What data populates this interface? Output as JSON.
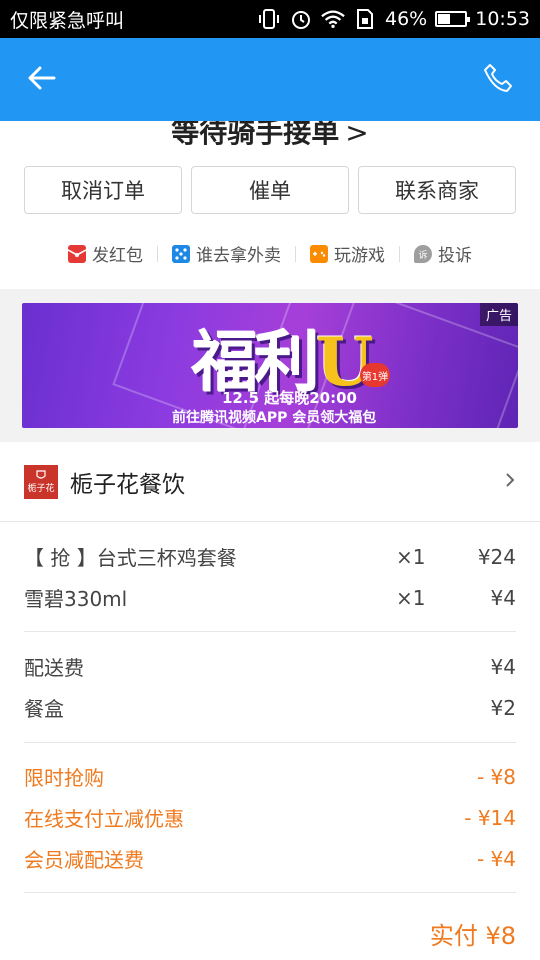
{
  "status_bar": {
    "carrier": "仅限紧急呼叫",
    "battery": "46%",
    "battery_level": 0.46,
    "time": "10:53",
    "icons": [
      "vibrate-icon",
      "alarm-icon",
      "wifi-icon",
      "sim-icon"
    ]
  },
  "app_bar": {
    "back_icon": "arrow-left-icon",
    "phone_icon": "phone-icon",
    "background": "#2196f3"
  },
  "order_status": {
    "title": "等待骑手接单",
    "chevron": ">"
  },
  "buttons": [
    {
      "label": "取消订单"
    },
    {
      "label": "催单"
    },
    {
      "label": "联系商家"
    }
  ],
  "actions": [
    {
      "label": "发红包",
      "icon": "red-envelope-icon",
      "color": "#e53935"
    },
    {
      "label": "谁去拿外卖",
      "icon": "dice-icon",
      "color": "#1e88e5"
    },
    {
      "label": "玩游戏",
      "icon": "gamepad-icon",
      "color": "#fb8c00"
    },
    {
      "label": "投诉",
      "icon": "complaint-icon",
      "color": "#9e9e9e"
    }
  ],
  "ad": {
    "tag": "广告",
    "headline_1": "福利",
    "headline_2": "U",
    "episode": "第1弹",
    "date": "12.5 起每晚20:00",
    "subtitle": "前往腾讯视频APP 会员领大福包"
  },
  "shop": {
    "name": "栀子花餐饮",
    "logo_text": "栀子花"
  },
  "items": [
    {
      "name": "【 抢 】台式三杯鸡套餐",
      "qty": "×1",
      "price": "¥24"
    },
    {
      "name": "雪碧330ml",
      "qty": "×1",
      "price": "¥4"
    }
  ],
  "fees": [
    {
      "name": "配送费",
      "price": "¥4"
    },
    {
      "name": "餐盒",
      "price": "¥2"
    }
  ],
  "discounts": [
    {
      "name": "限时抢购",
      "price": "- ¥8"
    },
    {
      "name": "在线支付立减优惠",
      "price": "- ¥14"
    },
    {
      "name": "会员减配送费",
      "price": "- ¥4"
    }
  ],
  "total": "实付 ¥8",
  "colors": {
    "accent": "#2196f3",
    "discount": "#f07a1f"
  }
}
